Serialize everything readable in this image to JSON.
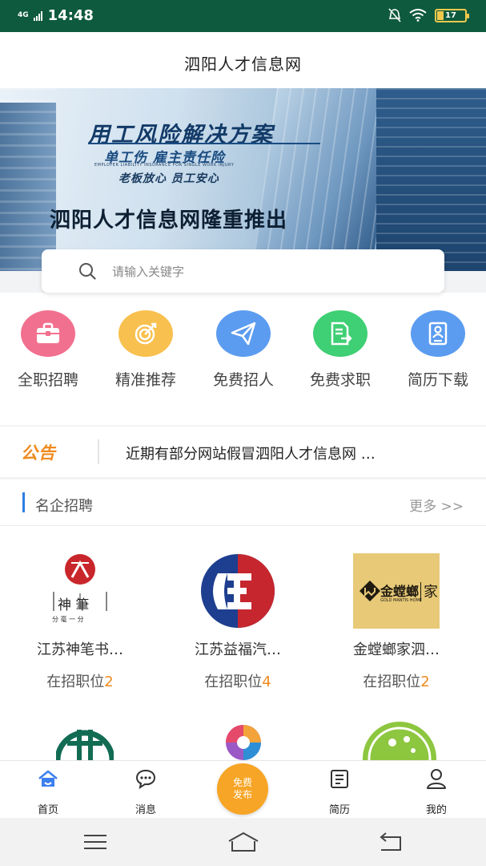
{
  "statusbar": {
    "network": "4G",
    "time": "14:48",
    "battery": "17"
  },
  "titlebar": {
    "title": "泗阳人才信息网"
  },
  "banner": {
    "headline": "用工风险解决方案",
    "subline": "单工伤  雇主责任险",
    "subline_en": "EMPLOYER LIABILITY INSURANCE FOR SINGLE WORK INJURY",
    "slogan": "老板放心 员工安心",
    "announce": "泗阳人才信息网隆重推出"
  },
  "search": {
    "placeholder": "请输入关键字"
  },
  "categories": [
    {
      "label": "全职招聘",
      "icon": "briefcase-icon",
      "color": "#f2708f"
    },
    {
      "label": "精准推荐",
      "icon": "target-icon",
      "color": "#f8c04e"
    },
    {
      "label": "免费招人",
      "icon": "paper-plane-icon",
      "color": "#5b9cf0"
    },
    {
      "label": "免费求职",
      "icon": "document-arrow-icon",
      "color": "#3fcf74"
    },
    {
      "label": "简历下载",
      "icon": "resume-icon",
      "color": "#5b9cf0"
    }
  ],
  "notice": {
    "tag": "公告",
    "text": "近期有部分网站假冒泗阳人才信息网 …"
  },
  "section": {
    "title": "名企招聘",
    "more": "更多 >>",
    "companies": [
      {
        "name": "江苏神笔书…",
        "count_label": "在招职位",
        "count": "2",
        "logo_text": "神  筆",
        "logo_sub": "分  毫  一  分"
      },
      {
        "name": "江苏益福汽…",
        "count_label": "在招职位",
        "count": "4"
      },
      {
        "name": "金螳螂家泗…",
        "count_label": "在招职位",
        "count": "2",
        "logo_text": "金螳螂",
        "logo_side": "家",
        "logo_en": "GOLD MANTIS HOME"
      }
    ]
  },
  "tabbar": {
    "tabs": [
      {
        "label": "首页",
        "icon": "home-icon"
      },
      {
        "label": "消息",
        "icon": "message-icon"
      },
      {
        "label": "简历",
        "icon": "resume-icon"
      },
      {
        "label": "我的",
        "icon": "user-icon"
      }
    ],
    "publish": {
      "line1": "免费",
      "line2": "发布"
    }
  }
}
